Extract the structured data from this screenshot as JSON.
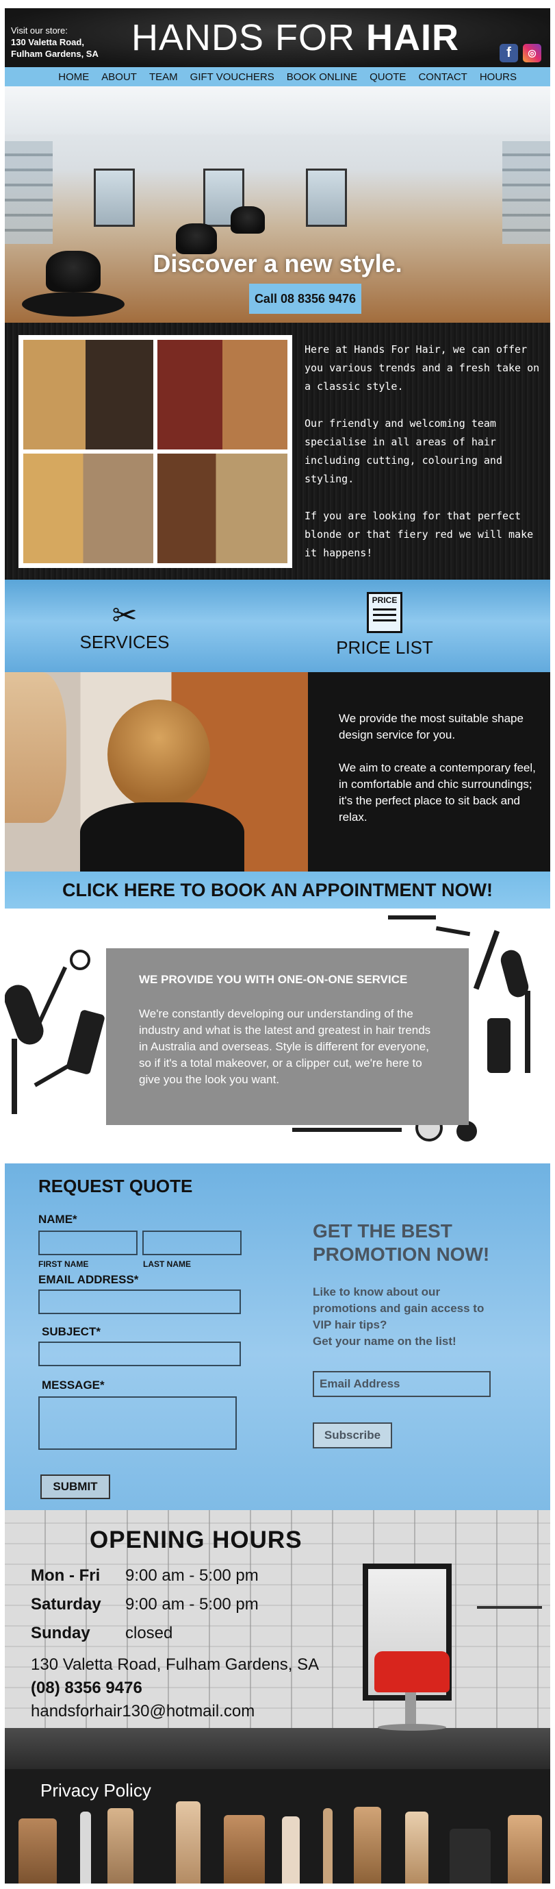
{
  "header": {
    "store_line1": "Visit our store:",
    "store_line2": "130 Valetta Road,",
    "store_line3": "Fulham Gardens, SA",
    "brand_part1": "HANDS  FOR  ",
    "brand_part2": "HAIR",
    "facebook_glyph": "f",
    "instagram_glyph": "◎"
  },
  "nav": {
    "items": [
      "HOME",
      "ABOUT",
      "TEAM",
      "GIFT VOUCHERS",
      "BOOK ONLINE",
      "QUOTE",
      "CONTACT",
      "HOURS"
    ]
  },
  "hero": {
    "headline": "Discover a new style.",
    "call_button": "Call 08 8356 9476"
  },
  "intro": {
    "paragraphs": [
      "Here at Hands For Hair, we can offer you various trends and a fresh take on a classic style.",
      "Our friendly and welcoming team specialise in all areas of hair including cutting, colouring and styling.",
      "If you are looking for that perfect blonde or that fiery red we will make it happens!"
    ]
  },
  "services_band": {
    "services_label": "SERVICES",
    "price_list_label": "PRICE LIST",
    "price_icon_text": "PRICE",
    "scissors_glyph": "✂"
  },
  "stylist": {
    "paragraphs": [
      "We provide the most suitable shape design service for you.",
      "We aim to create a contemporary feel, in comfortable and chic surroundings; it's the perfect place to sit back and relax."
    ]
  },
  "book_banner": "CLICK HERE TO BOOK AN APPOINTMENT NOW!",
  "one_on_one": {
    "heading": "WE PROVIDE YOU WITH ONE-ON-ONE SERVICE",
    "body": "We're constantly developing our understanding of the industry and what is the latest and greatest in hair trends in Australia and overseas. Style is different for everyone, so if it's a total makeover, or a clipper cut, we're here to give you the look you want."
  },
  "quote_form": {
    "title": "REQUEST QUOTE",
    "name_label": "NAME*",
    "first_name_label": "FIRST NAME",
    "last_name_label": "LAST NAME",
    "email_label": "EMAIL ADDRESS*",
    "subject_label": "SUBJECT*",
    "message_label": "MESSAGE*",
    "submit_label": "SUBMIT"
  },
  "promotion": {
    "title": "GET THE BEST PROMOTION NOW!",
    "line1": "Like to know about our promotions and gain access to VIP hair tips?",
    "line2": "Get your name on the list!",
    "email_placeholder": "Email Address",
    "subscribe_label": "Subscribe"
  },
  "hours": {
    "title": "OPENING  HOURS",
    "rows": [
      {
        "day": "Mon - Fri",
        "time": "9:00 am - 5:00 pm"
      },
      {
        "day": "Saturday",
        "time": "9:00 am - 5:00 pm"
      },
      {
        "day": "Sunday",
        "time": "closed"
      }
    ],
    "address": "130 Valetta Road, Fulham Gardens, SA",
    "phone": "(08) 8356 9476",
    "email": "handsforhair130@hotmail.com"
  },
  "footer": {
    "privacy_label": "Privacy Policy"
  },
  "colors": {
    "accent_blue": "#7ec2ea",
    "header_black": "#151515",
    "promo_text": "#4a5560",
    "chair_red": "#d8251d"
  }
}
